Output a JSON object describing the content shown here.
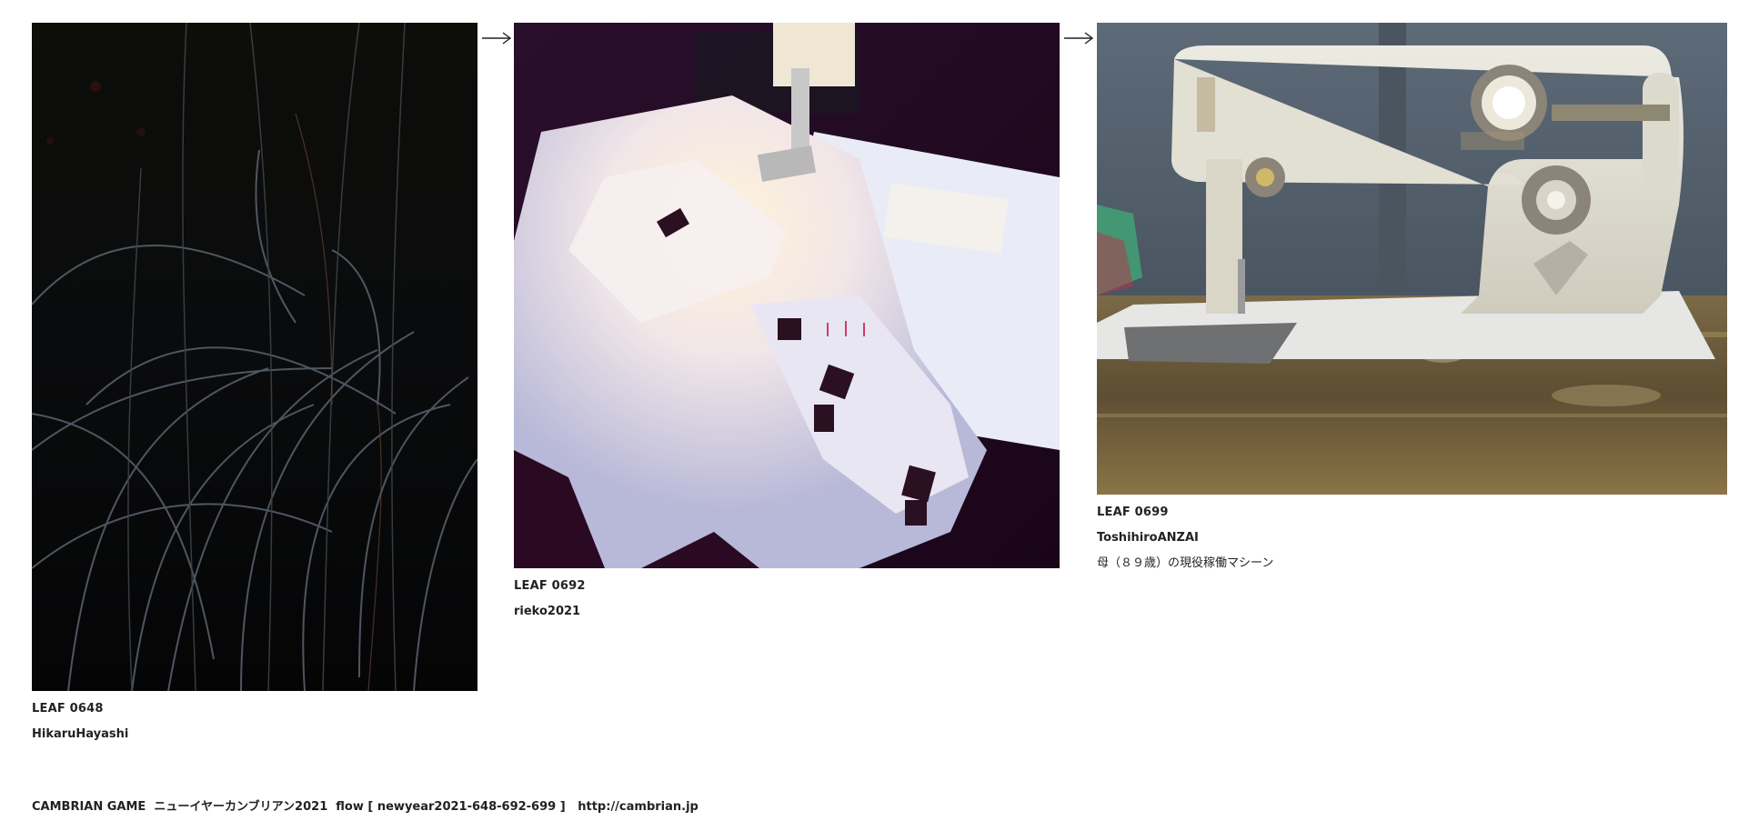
{
  "leaves": [
    {
      "code": "LEAF 0648",
      "author": "HikaruHayashi",
      "note": "",
      "image": "dark grass blades at night"
    },
    {
      "code": "LEAF 0692",
      "author": "rieko2021",
      "note": "",
      "image": "white fabric under a sewing machine foot"
    },
    {
      "code": "LEAF 0699",
      "author": "ToshihiroANZAI",
      "note": "母（８９歳）の現役稼働マシーン",
      "image": "vintage white Janome sewing machine on a wooden table"
    }
  ],
  "arrows": [
    "arrow-right-icon",
    "arrow-right-icon"
  ],
  "footer": {
    "text": "CAMBRIAN GAME  ニューイヤーカンブリアン2021  flow [ newyear2021-648-692-699 ]   ",
    "link": "http://cambrian.jp"
  }
}
